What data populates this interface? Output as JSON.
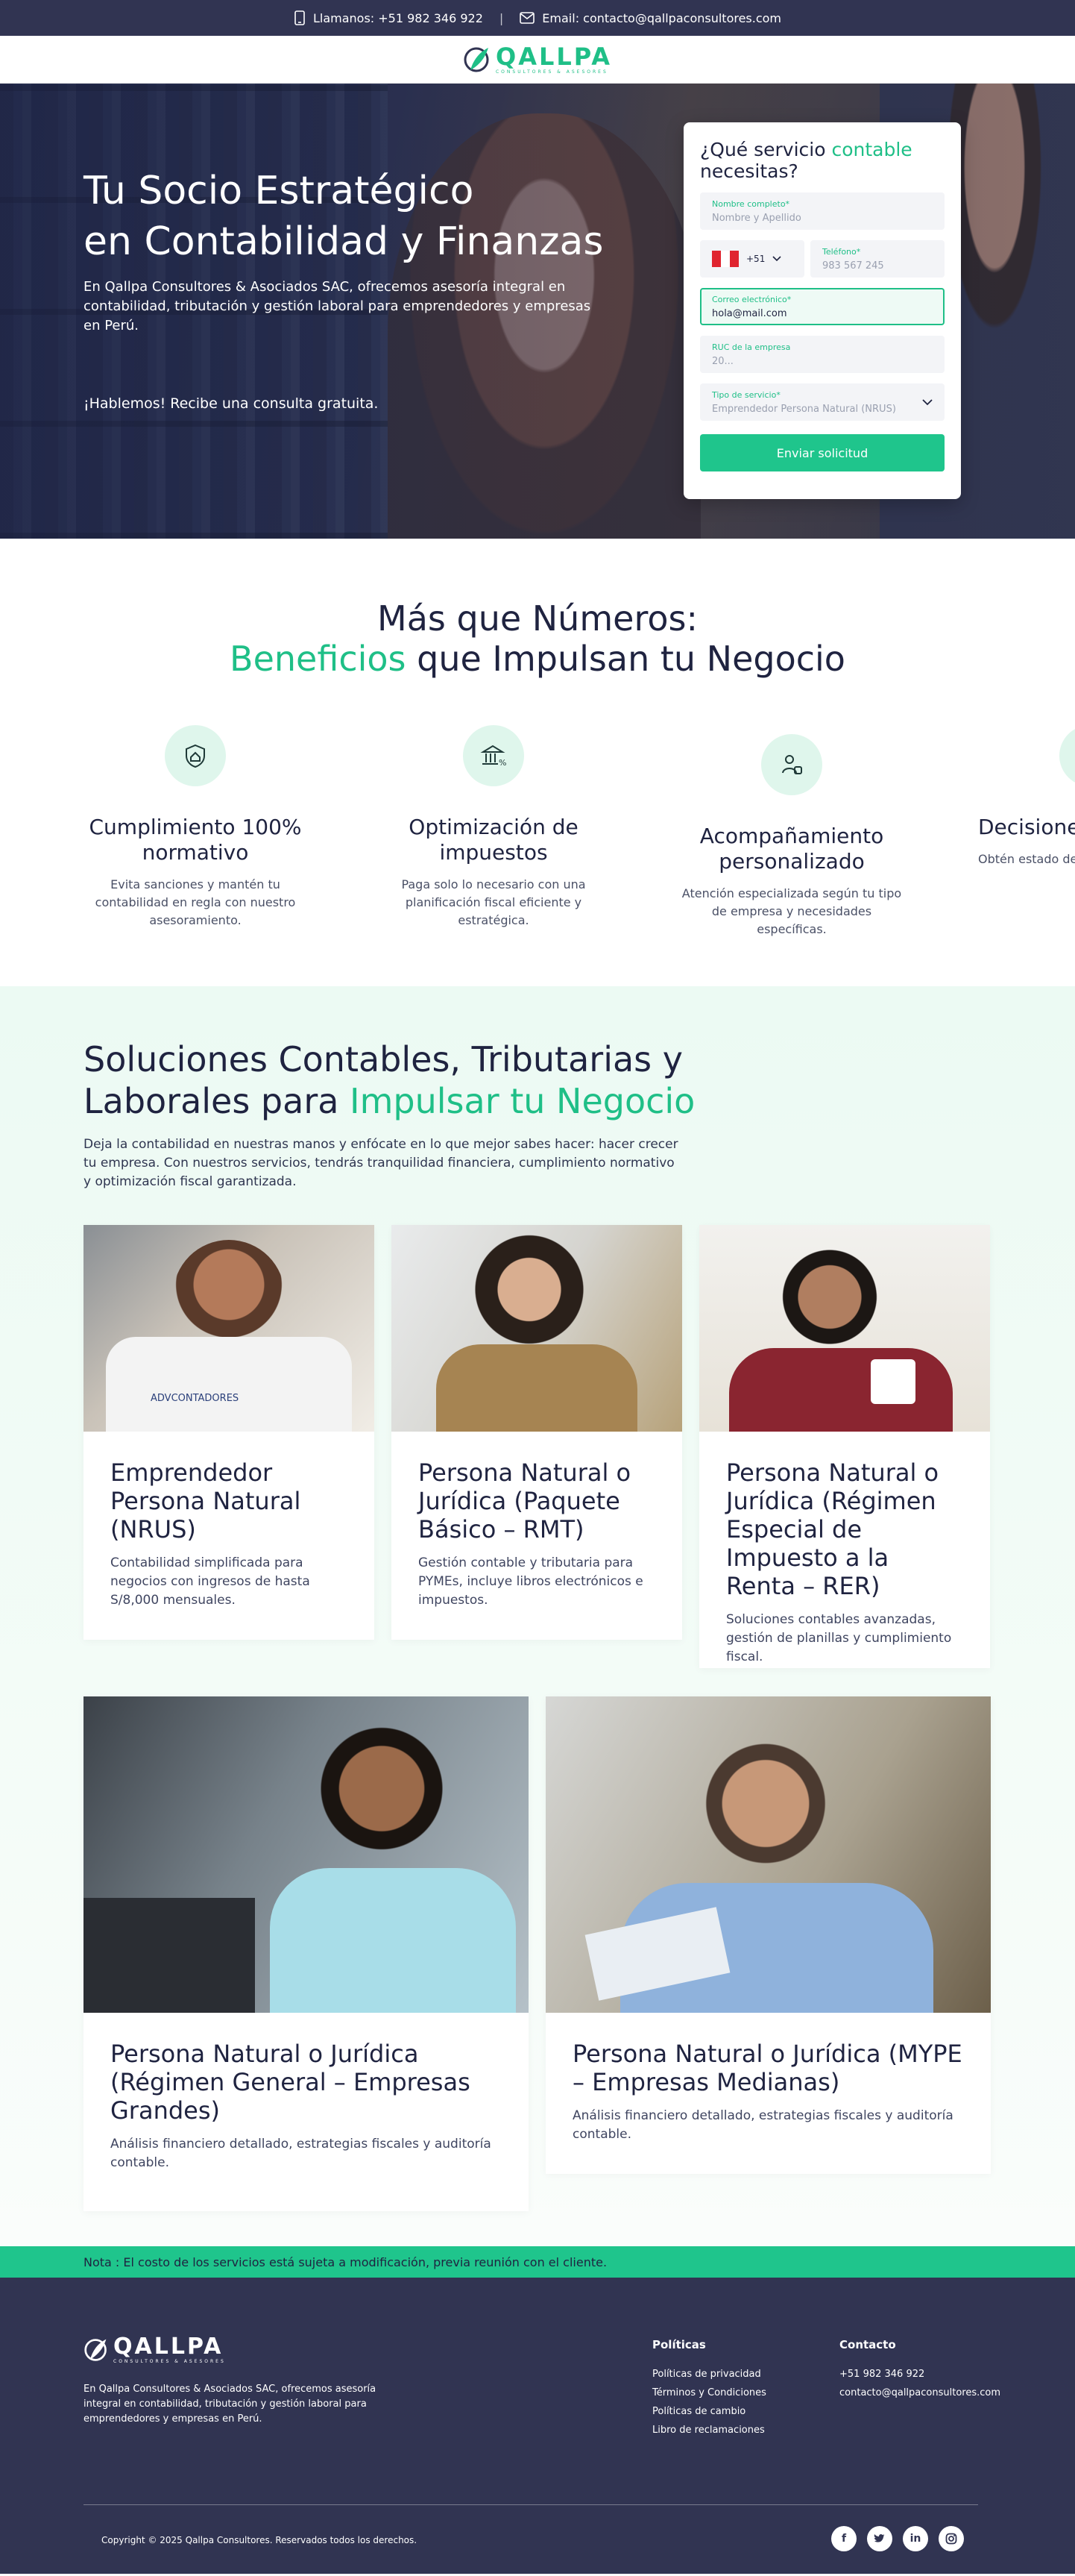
{
  "topbar": {
    "phone": "Llamanos: +51 982 346 922",
    "separator": "|",
    "email": "Email: contacto@qallpaconsultores.com"
  },
  "brand": {
    "name": "QALLPA",
    "tagline": "CONSULTORES & ASESORES"
  },
  "hero": {
    "title_line1": "Tu Socio Estratégico",
    "title_line2": "en Contabilidad y Finanzas",
    "subtitle": "En Qallpa Consultores & Asociados SAC, ofrecemos asesoría integral en contabilidad, tributación y gestión laboral para emprendedores y empresas en Perú.",
    "cta": "¡Hablemos! Recibe una consulta gratuita."
  },
  "form": {
    "title_a": "¿Qué servicio ",
    "title_b": "contable",
    "title_c": " necesitas?",
    "name_label": "Nombre completo*",
    "name_placeholder": "Nombre y Apellido",
    "country_code": "+51",
    "phone_label": "Teléfono*",
    "phone_placeholder": "983 567 245",
    "email_label": "Correo electrónico*",
    "email_value": "hola@mail.com",
    "ruc_label": "RUC de la empresa",
    "ruc_placeholder": "20...",
    "service_label": "Tipo de servicio*",
    "service_value": "Emprendedor Persona Natural (NRUS)",
    "submit": "Enviar solicitud"
  },
  "benefits": {
    "title_line1": "Más que Números:",
    "title_g": "Beneficios",
    "title_rest": " que Impulsan tu Negocio",
    "items": [
      {
        "icon": "shield-house-icon",
        "title": "Cumplimiento 100% normativo",
        "text": "Evita sanciones y mantén tu contabilidad en regla con nuestro asesoramiento."
      },
      {
        "icon": "bank-percent-icon",
        "title": "Optimización de impuestos",
        "text": "Paga solo lo necesario con una planificación fiscal eficiente y estratégica."
      },
      {
        "icon": "person-support-icon",
        "title": "Acompañamiento personalizado",
        "text": "Atención especializada según tu tipo de empresa y necesidades específicas."
      },
      {
        "icon": "chart-icon",
        "title": "Decisiones se",
        "text": "Obtén estado detallados p de"
      }
    ]
  },
  "solutions": {
    "title_a": "Soluciones Contables, Tributarias y Laborales para ",
    "title_g": "Impulsar tu Negocio",
    "lead": "Deja la contabilidad en nuestras manos y enfócate en lo que mejor sabes hacer: hacer crecer tu empresa. Con nuestros servicios, tendrás tranquilidad financiera, cumplimiento normativo y optimización fiscal garantizada.",
    "cards": [
      {
        "title": "Emprendedor Persona Natural (NRUS)",
        "text": "Contabilidad simplificada para negocios con ingresos de hasta S/8,000 mensuales.",
        "img_caption": "ADVCONTADORES"
      },
      {
        "title": "Persona Natural o Jurídica (Paquete Básico – RMT)",
        "text": "Gestión contable y tributaria para PYMEs, incluye libros electrónicos e impuestos."
      },
      {
        "title": "Persona Natural o Jurídica (Régimen Especial de Impuesto a la Renta – RER)",
        "text": "Soluciones contables avanzadas, gestión de planillas y cumplimiento fiscal."
      },
      {
        "title": "Persona Natural o Jurídica (Régimen General – Empresas Grandes)",
        "text": "Análisis financiero detallado, estrategias fiscales y auditoría contable."
      },
      {
        "title": "Persona Natural o Jurídica (MYPE – Empresas Medianas)",
        "text": "Análisis financiero detallado, estrategias fiscales y auditoría contable."
      }
    ]
  },
  "note": "Nota : El costo de los servicios está sujeta a modificación, previa reunión con el cliente.",
  "footer": {
    "description": "En Qallpa Consultores & Asociados SAC, ofrecemos asesoría integral en contabilidad, tributación y gestión laboral para emprendedores y empresas en Perú.",
    "policies_title": "Políticas",
    "policies": [
      "Políticas de privacidad",
      "Términos y Condiciones",
      "Políticas de cambio",
      "Libro de reclamaciones"
    ],
    "contact_title": "Contacto",
    "contact_phone": "+51 982 346 922",
    "contact_email": "contacto@qallpaconsultores.com",
    "copyright": "Copyright © 2025 Qallpa Consultores. Reservados todos los derechos.",
    "social": [
      "f",
      "t",
      "in",
      "ig"
    ]
  },
  "colors": {
    "accent": "#1fbf87",
    "navy": "#313452"
  }
}
